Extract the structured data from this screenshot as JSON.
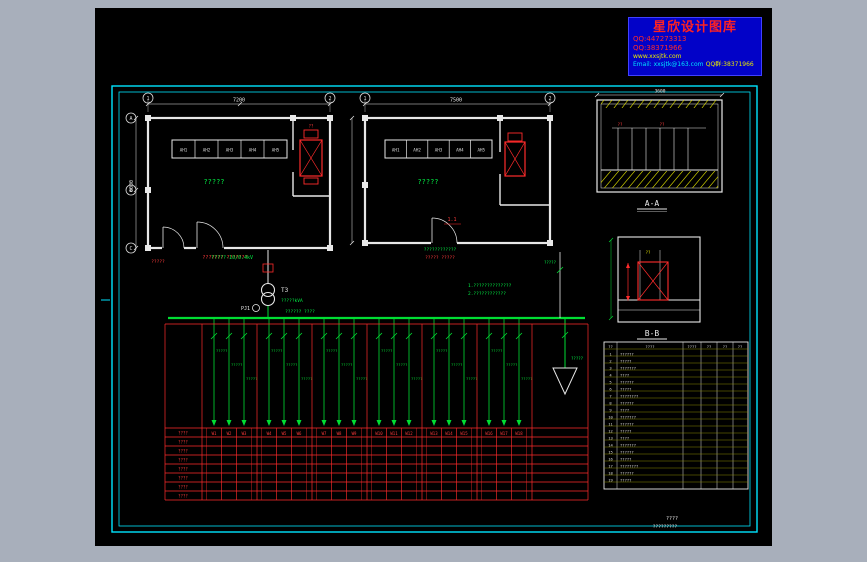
{
  "watermark": {
    "title": "星欣设计图库",
    "qq1": "QQ:447273313",
    "qq2": "QQ:38371966",
    "web": "www.xxsjtk.com",
    "email": "Email: xxsjtk@163.com",
    "tail": "QQ群:38371966"
  },
  "plans": {
    "left": {
      "room_label": "?????",
      "panels": [
        "AH1",
        "AH2",
        "AH3",
        "AH4",
        "AH5"
      ],
      "note": "??????? ???????",
      "corner_note": "?????",
      "tx_tag": "??",
      "dim_top": "7200",
      "dim_left": "6000",
      "axis_top": [
        "1",
        "2"
      ],
      "axis_left": [
        "A",
        "B",
        "C"
      ]
    },
    "right": {
      "room_label": "?????",
      "panels": [
        "AH1",
        "AH2",
        "AH3",
        "AH4",
        "AH5"
      ],
      "note": "????? ?????",
      "green_note": "????????????",
      "tag": "1.1",
      "dim_top": "7500",
      "axis_top": [
        "1",
        "2"
      ]
    }
  },
  "sections": {
    "a": {
      "label": "A-A",
      "dim_top": "3600",
      "marks": [
        "??",
        "??"
      ]
    },
    "b": {
      "label": "B-B",
      "tag": "??"
    }
  },
  "schematic": {
    "incoming_note": "?????-10/0.4kV",
    "bus_note": "?????? ????",
    "transformer_tag": "T3",
    "transformer_spec": "?????kVA",
    "meter_tag": "PJ1",
    "riser_note": "?????",
    "cap_note": "?????",
    "notes": [
      "1.??????????????",
      "2.????????????"
    ],
    "feeder_label": "?????",
    "circuits": [
      "W1",
      "W2",
      "W3",
      "W4",
      "W5",
      "W6",
      "W7",
      "W8",
      "W9",
      "W10",
      "W11",
      "W12",
      "W13",
      "W14",
      "W15",
      "W16",
      "W17",
      "W18"
    ],
    "row_labels": [
      "????",
      "????",
      "????",
      "????",
      "????",
      "????",
      "????",
      "????"
    ]
  },
  "equipment_table": {
    "headers": [
      "??",
      "????",
      "????",
      "??",
      "??",
      "??"
    ],
    "rows": [
      {
        "no": "1",
        "name": "??????"
      },
      {
        "no": "2",
        "name": "?????"
      },
      {
        "no": "3",
        "name": "???????"
      },
      {
        "no": "4",
        "name": "????"
      },
      {
        "no": "5",
        "name": "??????"
      },
      {
        "no": "6",
        "name": "?????"
      },
      {
        "no": "7",
        "name": "????????"
      },
      {
        "no": "8",
        "name": "??????"
      },
      {
        "no": "9",
        "name": "????"
      },
      {
        "no": "10",
        "name": "???????"
      },
      {
        "no": "11",
        "name": "??????"
      },
      {
        "no": "12",
        "name": "?????"
      },
      {
        "no": "13",
        "name": "????"
      },
      {
        "no": "14",
        "name": "???????"
      },
      {
        "no": "15",
        "name": "??????"
      },
      {
        "no": "16",
        "name": "?????"
      },
      {
        "no": "17",
        "name": "????????"
      },
      {
        "no": "18",
        "name": "??????"
      },
      {
        "no": "19",
        "name": "?????"
      }
    ]
  },
  "titleblock": {
    "line1": "????",
    "line2": "?????????"
  }
}
